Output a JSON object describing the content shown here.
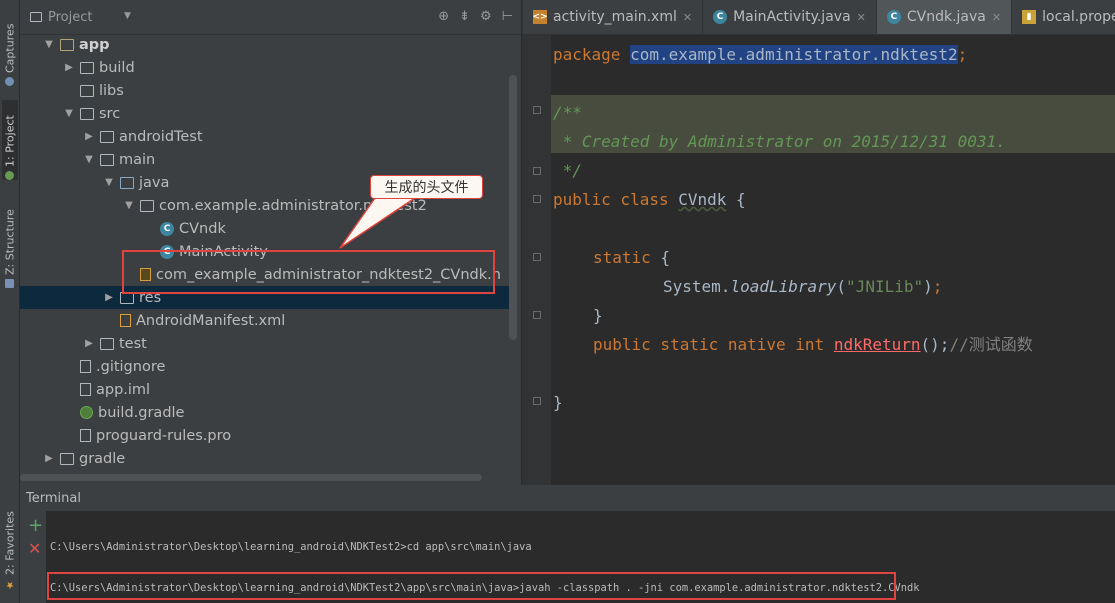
{
  "left_strip": {
    "tabs": [
      {
        "label": "Captures"
      },
      {
        "label": "1: Project"
      },
      {
        "label": "Z: Structure"
      },
      {
        "label": "2: Favorites"
      }
    ]
  },
  "project_panel": {
    "title": "Project",
    "tree": [
      {
        "label": "app",
        "arrow": "▼",
        "icon": "module-folder",
        "depth": 0,
        "bold": true
      },
      {
        "label": "build",
        "arrow": "▶",
        "icon": "folder",
        "depth": 1
      },
      {
        "label": "libs",
        "arrow": "",
        "icon": "folder",
        "depth": 1
      },
      {
        "label": "src",
        "arrow": "▼",
        "icon": "folder",
        "depth": 1
      },
      {
        "label": "androidTest",
        "arrow": "▶",
        "icon": "folder",
        "depth": 2
      },
      {
        "label": "main",
        "arrow": "▼",
        "icon": "folder",
        "depth": 2
      },
      {
        "label": "java",
        "arrow": "▼",
        "icon": "source-folder",
        "depth": 3
      },
      {
        "label": "com.example.administrator.ndktest2",
        "arrow": "▼",
        "icon": "package-folder",
        "depth": 4
      },
      {
        "label": "CVndk",
        "arrow": "",
        "icon": "class",
        "depth": 5
      },
      {
        "label": "MainActivity",
        "arrow": "",
        "icon": "class",
        "depth": 5
      },
      {
        "label": "com_example_administrator_ndktest2_CVndk.h",
        "arrow": "",
        "icon": "header-file",
        "depth": 4
      },
      {
        "label": "res",
        "arrow": "▶",
        "icon": "resource-folder",
        "depth": 3,
        "selected": true
      },
      {
        "label": "AndroidManifest.xml",
        "arrow": "",
        "icon": "xml-file",
        "depth": 3
      },
      {
        "label": "test",
        "arrow": "▶",
        "icon": "folder",
        "depth": 2
      },
      {
        "label": ".gitignore",
        "arrow": "",
        "icon": "file",
        "depth": 1
      },
      {
        "label": "app.iml",
        "arrow": "",
        "icon": "file",
        "depth": 1
      },
      {
        "label": "build.gradle",
        "arrow": "",
        "icon": "gradle-file",
        "depth": 1
      },
      {
        "label": "proguard-rules.pro",
        "arrow": "",
        "icon": "file",
        "depth": 1
      },
      {
        "label": "gradle",
        "arrow": "▶",
        "icon": "folder",
        "depth": 0
      }
    ],
    "callout": "生成的头文件"
  },
  "editor": {
    "tabs": [
      {
        "label": "activity_main.xml",
        "icon": "xml-file-icon",
        "active": false
      },
      {
        "label": "MainActivity.java",
        "icon": "class-icon",
        "active": false
      },
      {
        "label": "CVndk.java",
        "icon": "class-icon",
        "active": true
      },
      {
        "label": "local.properties",
        "icon": "properties-file-icon",
        "active": false
      }
    ],
    "code": {
      "package_kw": "package",
      "package_name": "com.example.administrator.ndktest2",
      "semicolon": ";",
      "doc_open": "/**",
      "doc_body": " * Created by Administrator on 2015/12/31 0031.",
      "doc_close": " */",
      "class_kw": "public class",
      "class_name": "CVndk",
      "brace_open": " {",
      "static_kw": "static",
      "system": "System.",
      "load_fn": "loadLibrary",
      "lib_str": "\"JNILib\"",
      "close_brace": "}",
      "native_decl": "public static native int",
      "native_fn": "ndkReturn",
      "native_tail": "();",
      "native_comment": "//测试函数"
    }
  },
  "terminal": {
    "title": "Terminal",
    "lines": [
      "C:\\Users\\Administrator\\Desktop\\learning_android\\NDKTest2>cd app\\src\\main\\java",
      "C:\\Users\\Administrator\\Desktop\\learning_android\\NDKTest2\\app\\src\\main\\java>javah -classpath . -jni com.example.administrator.ndktest2.CVndk"
    ]
  }
}
